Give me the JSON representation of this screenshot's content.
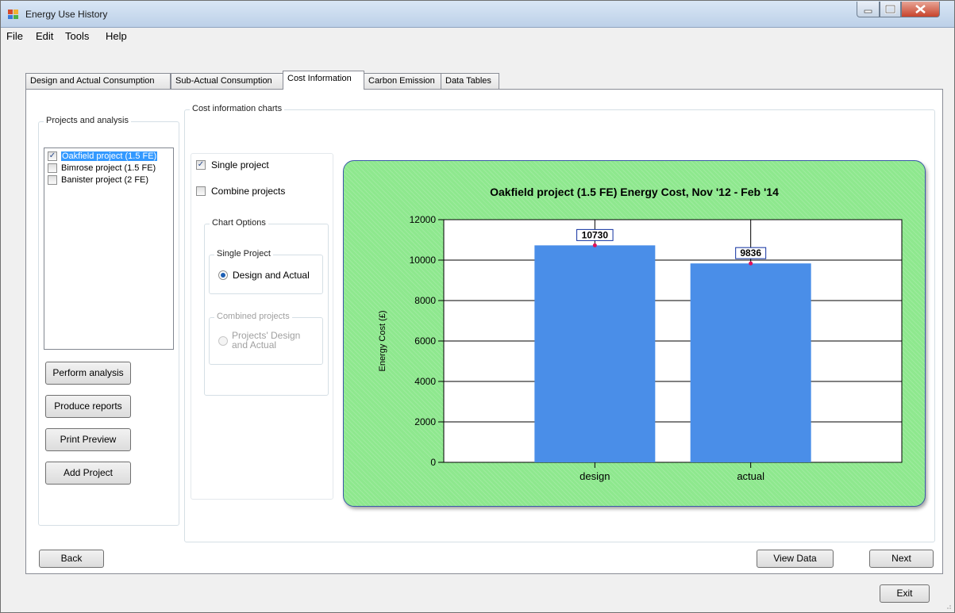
{
  "window": {
    "title": "Energy Use History"
  },
  "menu": [
    "File",
    "Edit",
    "Tools",
    "Help"
  ],
  "tabs": [
    "Design and Actual Consumption",
    "Sub-Actual Consumption",
    "Cost Information",
    "Carbon Emission",
    "Data Tables"
  ],
  "active_tab": "Cost Information",
  "projects_panel": {
    "label": "Projects and analysis",
    "items": [
      {
        "label": "Oakfield project (1.5 FE)",
        "checked": true,
        "selected": true
      },
      {
        "label": "Bimrose project (1.5 FE)",
        "checked": false,
        "selected": false
      },
      {
        "label": "Banister project (2 FE)",
        "checked": false,
        "selected": false
      }
    ],
    "buttons": {
      "perform": "Perform analysis",
      "reports": "Produce reports",
      "preview": "Print Preview",
      "add": "Add Project"
    }
  },
  "cost_panel": {
    "label": "Cost information charts",
    "single_project": "Single project",
    "combine_projects": "Combine projects",
    "chart_options": "Chart Options",
    "single_group": "Single Project",
    "design_actual": "Design and Actual",
    "combined_group": "Combined projects",
    "projects_design_actual": "Projects' Design and Actual"
  },
  "footer": {
    "back": "Back",
    "view_data": "View Data",
    "next": "Next",
    "exit": "Exit"
  },
  "colors": {
    "bar": "#4a8ee8",
    "chart_bg": "#8ee88e",
    "marker": "#e0105a",
    "selection": "#3399ff"
  },
  "chart_data": {
    "type": "bar",
    "title": "Oakfield project (1.5 FE) Energy Cost, Nov '12 - Feb '14",
    "xlabel": "",
    "ylabel": "Energy Cost (£)",
    "categories": [
      "design",
      "actual"
    ],
    "values": [
      10730,
      9836
    ],
    "data_labels": [
      "10730",
      "9836"
    ],
    "ylim": [
      0,
      12000
    ],
    "yticks": [
      "0",
      "2000",
      "4000",
      "6000",
      "8000",
      "10000",
      "12000"
    ],
    "grid": true
  }
}
